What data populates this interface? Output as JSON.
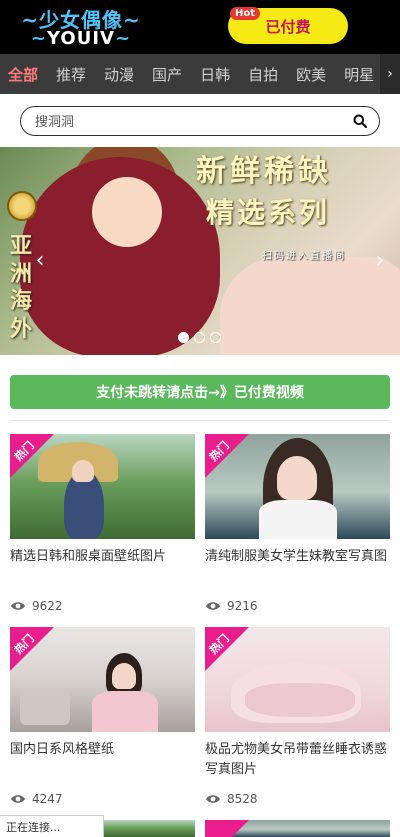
{
  "brand": {
    "logo_line1": "~少女偶像~",
    "logo_line2_left": "~",
    "logo_line2_name": "YOUIV",
    "logo_line2_right": "~"
  },
  "header": {
    "paid_label": "已付费",
    "hot_tag": "Hot"
  },
  "categories": [
    {
      "label": "全部",
      "active": true
    },
    {
      "label": "推荐",
      "active": false
    },
    {
      "label": "动漫",
      "active": false
    },
    {
      "label": "国产",
      "active": false
    },
    {
      "label": "日韩",
      "active": false
    },
    {
      "label": "自拍",
      "active": false
    },
    {
      "label": "欧美",
      "active": false
    },
    {
      "label": "明星",
      "active": false
    }
  ],
  "search": {
    "placeholder": "搜洞洞",
    "value": ""
  },
  "banner": {
    "headline_line1": "新鲜稀缺",
    "headline_line2": "精选系列",
    "subtext": "扫码进入直播间",
    "side_text": "亚洲海外",
    "slide_count": 3,
    "active_slide": 1
  },
  "cta": {
    "label": "支付未跳转请点击→》已付费视频"
  },
  "cards": [
    {
      "badge": "热门",
      "title": "精选日韩和服桌面壁纸图片",
      "views": "9622"
    },
    {
      "badge": "热门",
      "title": "清纯制服美女学生妹教室写真图",
      "views": "9216"
    },
    {
      "badge": "热门",
      "title": "国内日系风格壁纸",
      "views": "4247"
    },
    {
      "badge": "热门",
      "title": "极品尤物美女吊带蕾丝睡衣诱惑写真图片",
      "views": "8528"
    }
  ],
  "status": {
    "text": "正在连接..."
  },
  "colors": {
    "accent_green": "#5cb85c",
    "badge_pink": "#e91e8c",
    "paid_yellow": "#f6ea14",
    "nav_bg": "#3b3b3b"
  }
}
